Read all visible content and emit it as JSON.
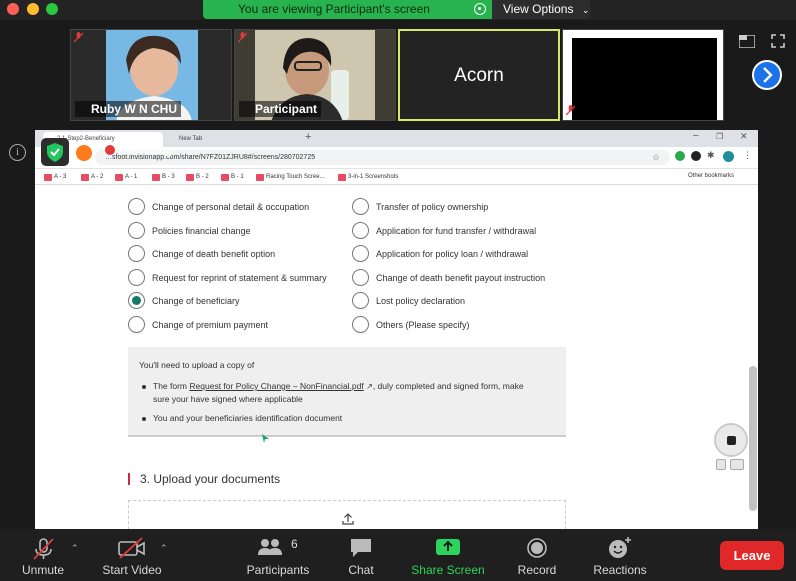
{
  "banner": {
    "viewing_text": "You are viewing Participant's screen",
    "view_options_label": "View Options"
  },
  "participants_strip": {
    "tiles": [
      {
        "name": "Ruby W N CHU"
      },
      {
        "name": "Participant"
      },
      {
        "name": "Acorn"
      },
      {
        "name": ""
      }
    ]
  },
  "recording_label": "Recording",
  "browser": {
    "tabs": [
      {
        "label": "2.1-Step2-Beneficiary"
      },
      {
        "label": "New Tab"
      }
    ],
    "url": "…sfoot.invisionapp.com/share/N7FZ01ZJRU8#/screens/280702725",
    "bookmarks": [
      "A - 3",
      "A - 2",
      "A - 1",
      "B - 3",
      "B - 2",
      "B - 1",
      "Racing Touch Scree...",
      "3-in-1 Screenshots"
    ],
    "other_bookmarks": "Other bookmarks"
  },
  "form": {
    "left_options": [
      {
        "label": "Change of personal detail & occupation",
        "selected": false
      },
      {
        "label": "Policies financial change",
        "selected": false
      },
      {
        "label": "Change of death benefit option",
        "selected": false
      },
      {
        "label": "Request for reprint of statement & summary",
        "selected": false
      },
      {
        "label": "Change of beneficiary",
        "selected": true
      },
      {
        "label": "Change of premium payment",
        "selected": false
      }
    ],
    "right_options": [
      {
        "label": "Transfer of policy ownership",
        "selected": false
      },
      {
        "label": "Application for fund transfer / withdrawal",
        "selected": false
      },
      {
        "label": "Application for policy loan / withdrawal",
        "selected": false
      },
      {
        "label": "Change of death benefit payout instruction",
        "selected": false
      },
      {
        "label": "Lost policy declaration",
        "selected": false
      },
      {
        "label": "Others (Please specify)",
        "selected": false
      }
    ],
    "notice": {
      "title": "You'll need to upload a copy of",
      "item1_prefix": "The form",
      "item1_link": "Request for Policy Change – NonFinancial.pdf",
      "item1_suffix": ", duly completed and signed form, make",
      "item1_line2": "sure your have signed where applicable",
      "item2": "You and your beneficiaries identification document"
    },
    "section3_title": "3. Upload your documents"
  },
  "toolbar": {
    "unmute": "Unmute",
    "start_video": "Start Video",
    "participants": "Participants",
    "participants_count": "6",
    "chat": "Chat",
    "share_screen": "Share Screen",
    "record": "Record",
    "reactions": "Reactions",
    "leave": "Leave"
  },
  "colors": {
    "zoom_green": "#27b44e",
    "leave_red": "#e02828",
    "radio_selected": "#14796a",
    "section_accent": "#d0293b"
  }
}
